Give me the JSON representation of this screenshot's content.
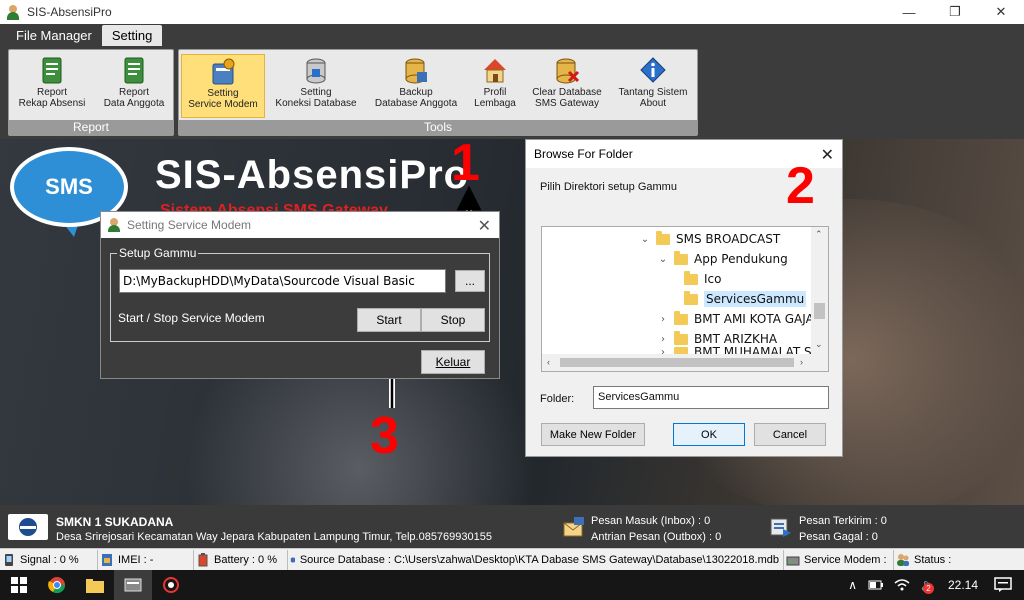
{
  "window": {
    "title": "SIS-AbsensiPro",
    "buttons": {
      "minimize": "—",
      "maximize": "❐",
      "close": "✕"
    }
  },
  "ribbon": {
    "tabs": [
      {
        "label": "File Manager"
      },
      {
        "label": "Setting"
      }
    ],
    "groups": {
      "report": {
        "caption": "Report",
        "items": [
          {
            "line1": "Report",
            "line2": "Rekap Absensi",
            "icon": "report-icon"
          },
          {
            "line1": "Report",
            "line2": "Data Anggota",
            "icon": "report-icon"
          }
        ]
      },
      "tools": {
        "caption": "Tools",
        "items": [
          {
            "line1": "Setting",
            "line2": "Service Modem",
            "icon": "modem-settings-icon"
          },
          {
            "line1": "Setting",
            "line2": "Koneksi Database",
            "icon": "database-connection-icon"
          },
          {
            "line1": "Backup",
            "line2": "Database Anggota",
            "icon": "database-backup-icon"
          },
          {
            "line1": "Profil",
            "line2": "Lembaga",
            "icon": "house-icon"
          },
          {
            "line1": "Clear Database",
            "line2": "SMS Gateway",
            "icon": "database-clear-icon"
          },
          {
            "line1": "Tantang Sistem",
            "line2": "About",
            "icon": "info-icon"
          }
        ]
      }
    }
  },
  "banner": {
    "bubble": "SMS",
    "brand": "SIS-AbsensiPro",
    "sub": "Sistem Absensi SMS Gateway"
  },
  "annotations": {
    "one": "1",
    "two": "2",
    "three": "3"
  },
  "modem_dialog": {
    "title": "Setting Service Modem",
    "group_label": "Setup Gammu",
    "path_value": "D:\\MyBackupHDD\\MyData\\Sourcode Visual Basic",
    "browse_label": "...",
    "service_label": "Start / Stop Service Modem",
    "start_label": "Start",
    "stop_label": "Stop",
    "exit_label": "Keluar"
  },
  "folder_dialog": {
    "title": "Browse For Folder",
    "instruction": "Pilih Direktori setup Gammu",
    "tree": [
      {
        "label": "SMS BROADCAST",
        "chev": "⌄"
      },
      {
        "label": "App Pendukung",
        "chev": "⌄"
      },
      {
        "label": "Ico",
        "chev": ""
      },
      {
        "label": "ServicesGammu",
        "chev": ""
      },
      {
        "label": "BMT AMI KOTA GAJAH",
        "chev": "›"
      },
      {
        "label": "BMT ARIZKHA",
        "chev": "›"
      },
      {
        "label": "BMT MUHAMALAT SEJAHTERA",
        "chev": "›"
      }
    ],
    "folder_label": "Folder:",
    "folder_value": "ServicesGammu",
    "make_folder_label": "Make New Folder",
    "ok_label": "OK",
    "cancel_label": "Cancel"
  },
  "school": {
    "name": "SMKN 1 SUKADANA",
    "address": "Desa Srirejosari Kecamatan Way Jepara Kabupaten Lampung Timur, Telp.085769930155",
    "inbox": "Pesan Masuk (Inbox) : 0",
    "outbox": "Antrian Pesan (Outbox) : 0",
    "sent": "Pesan Terkirim : 0",
    "failed": "Pesan Gagal : 0"
  },
  "statusbar": {
    "signal": "Signal : 0 %",
    "imei": "IMEI : -",
    "battery": "Battery : 0 %",
    "source": "Source Database : C:\\Users\\zahwa\\Desktop\\KTA Dabase SMS Gateway\\Database\\13022018.mdb",
    "modem": "Service Modem :",
    "status": "Status :"
  },
  "taskbar": {
    "time": "22.14",
    "badge": "2"
  },
  "colors": {
    "accent_active": "#ffdf7a",
    "annotation": "#ff0000",
    "sms_blue": "#2e8fd6"
  }
}
